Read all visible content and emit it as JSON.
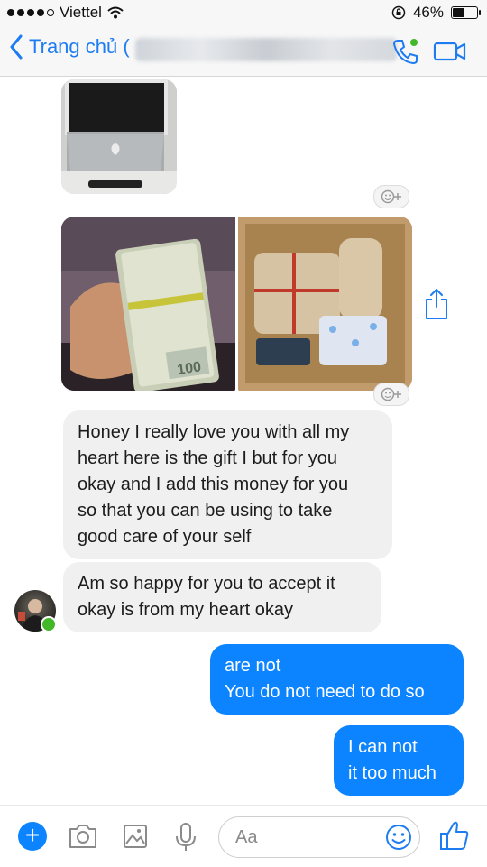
{
  "status_bar": {
    "carrier": "Viettel",
    "battery": "46%",
    "battery_level": 0.46
  },
  "nav": {
    "back_label": "Trang chủ ("
  },
  "composer": {
    "placeholder": "Aa"
  },
  "messages": [
    {
      "side": "in",
      "lines": [
        "Honey I really love you with all my",
        "heart here is the gift I but for you",
        "okay and I add this money for you",
        "so that you can be using to take",
        "good care of your self"
      ]
    },
    {
      "side": "in",
      "lines": [
        "Am so happy for you to accept it",
        "okay is from my heart okay"
      ]
    },
    {
      "side": "out",
      "lines": [
        "are not",
        "You do not need to do so"
      ]
    },
    {
      "side": "out",
      "lines": [
        "I can not",
        "it too much"
      ]
    }
  ],
  "colors": {
    "accent": "#0c84ff",
    "nav_blue": "#1d7cf2",
    "incoming": "#f1f0f0",
    "online": "#42b72a"
  },
  "icons": [
    "wifi-icon",
    "lock-rotation-icon",
    "back-chevron-icon",
    "phone-icon",
    "video-icon",
    "reaction-icon",
    "share-icon",
    "plus-icon",
    "camera-icon",
    "gallery-icon",
    "microphone-icon",
    "emoji-icon",
    "thumbs-up-icon"
  ]
}
